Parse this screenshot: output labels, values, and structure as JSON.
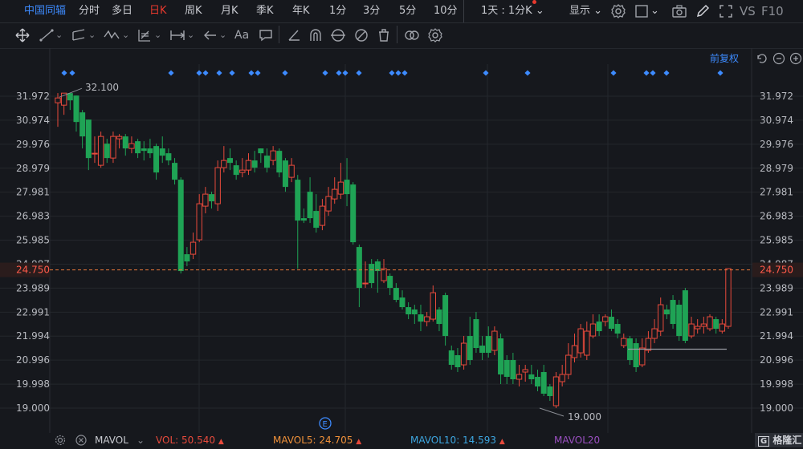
{
  "header": {
    "stock_name": "中国同辐",
    "periods": [
      "分时",
      "多日",
      "日K",
      "周K",
      "月K",
      "季K",
      "年K",
      "1分",
      "3分",
      "5分",
      "10分"
    ],
    "active_period": "日K",
    "interval_label": "1天 : 1分K",
    "display_label": "显示",
    "compare_label": "VS",
    "f10_label": "F10"
  },
  "toolbar": {
    "font_tool_label": "Aa"
  },
  "chart_area": {
    "adjust_label": "前复权"
  },
  "chart_data": {
    "type": "candlestick",
    "y_ticks": [
      "31.972",
      "30.974",
      "29.976",
      "28.979",
      "27.981",
      "26.983",
      "25.985",
      "24.987",
      "23.989",
      "22.991",
      "21.994",
      "20.996",
      "19.998",
      "19.000"
    ],
    "y_min": 19.0,
    "y_max": 31.972,
    "current_price": "24.750",
    "max_label": "32.100",
    "min_label": "19.000",
    "up_color": "#e84a3c",
    "down_color": "#1fa355",
    "candles": [
      {
        "o": 31.7,
        "c": 31.9,
        "h": 32.1,
        "l": 30.7
      },
      {
        "o": 31.6,
        "c": 32.1,
        "h": 32.1,
        "l": 31.2
      },
      {
        "o": 32.1,
        "c": 31.8,
        "h": 32.1,
        "l": 31.4
      },
      {
        "o": 32.0,
        "c": 30.9,
        "h": 32.0,
        "l": 30.5
      },
      {
        "o": 31.3,
        "c": 30.3,
        "h": 31.4,
        "l": 29.8
      },
      {
        "o": 31.0,
        "c": 29.4,
        "h": 31.0,
        "l": 28.9
      },
      {
        "o": 29.6,
        "c": 29.6,
        "h": 30.3,
        "l": 29.2
      },
      {
        "o": 29.1,
        "c": 30.3,
        "h": 30.5,
        "l": 29.0
      },
      {
        "o": 30.0,
        "c": 29.4,
        "h": 30.2,
        "l": 29.2
      },
      {
        "o": 29.4,
        "c": 30.3,
        "h": 30.5,
        "l": 29.2
      },
      {
        "o": 30.2,
        "c": 30.3,
        "h": 30.4,
        "l": 29.8
      },
      {
        "o": 30.3,
        "c": 29.8,
        "h": 30.4,
        "l": 29.5
      },
      {
        "o": 29.8,
        "c": 30.0,
        "h": 30.3,
        "l": 29.6
      },
      {
        "o": 30.1,
        "c": 29.6,
        "h": 30.2,
        "l": 29.4
      },
      {
        "o": 29.8,
        "c": 29.7,
        "h": 30.1,
        "l": 29.3
      },
      {
        "o": 29.8,
        "c": 29.6,
        "h": 30.2,
        "l": 29.4
      },
      {
        "o": 29.9,
        "c": 28.8,
        "h": 30.0,
        "l": 28.5
      },
      {
        "o": 29.8,
        "c": 29.5,
        "h": 30.3,
        "l": 29.2
      },
      {
        "o": 29.6,
        "c": 29.3,
        "h": 29.8,
        "l": 29.1
      },
      {
        "o": 29.2,
        "c": 28.5,
        "h": 29.4,
        "l": 28.3
      },
      {
        "o": 28.5,
        "c": 24.7,
        "h": 28.6,
        "l": 24.6
      },
      {
        "o": 25.4,
        "c": 25.1,
        "h": 25.7,
        "l": 24.9
      },
      {
        "o": 25.4,
        "c": 25.9,
        "h": 26.3,
        "l": 25.2
      },
      {
        "o": 26.0,
        "c": 27.5,
        "h": 27.9,
        "l": 25.9
      },
      {
        "o": 27.4,
        "c": 27.9,
        "h": 28.2,
        "l": 27.1
      },
      {
        "o": 27.9,
        "c": 27.6,
        "h": 28.0,
        "l": 27.3
      },
      {
        "o": 27.5,
        "c": 29.0,
        "h": 29.3,
        "l": 27.2
      },
      {
        "o": 29.0,
        "c": 29.3,
        "h": 29.9,
        "l": 28.8
      },
      {
        "o": 29.4,
        "c": 29.2,
        "h": 29.8,
        "l": 28.9
      },
      {
        "o": 29.1,
        "c": 28.7,
        "h": 29.3,
        "l": 28.5
      },
      {
        "o": 28.8,
        "c": 28.9,
        "h": 29.4,
        "l": 28.6
      },
      {
        "o": 28.9,
        "c": 29.3,
        "h": 29.6,
        "l": 28.7
      },
      {
        "o": 29.3,
        "c": 29.0,
        "h": 29.7,
        "l": 28.8
      },
      {
        "o": 29.8,
        "c": 29.6,
        "h": 29.8,
        "l": 29.2
      },
      {
        "o": 29.5,
        "c": 29.0,
        "h": 29.8,
        "l": 28.8
      },
      {
        "o": 29.3,
        "c": 29.7,
        "h": 29.9,
        "l": 29.1
      },
      {
        "o": 29.7,
        "c": 28.8,
        "h": 29.8,
        "l": 28.6
      },
      {
        "o": 29.3,
        "c": 28.2,
        "h": 29.4,
        "l": 28.0
      },
      {
        "o": 28.6,
        "c": 29.1,
        "h": 29.4,
        "l": 28.4
      },
      {
        "o": 28.5,
        "c": 26.8,
        "h": 28.7,
        "l": 24.8
      },
      {
        "o": 26.9,
        "c": 26.8,
        "h": 27.3,
        "l": 26.7
      },
      {
        "o": 28.0,
        "c": 26.9,
        "h": 28.6,
        "l": 26.7
      },
      {
        "o": 27.2,
        "c": 26.5,
        "h": 27.9,
        "l": 26.3
      },
      {
        "o": 26.6,
        "c": 27.4,
        "h": 27.7,
        "l": 26.4
      },
      {
        "o": 27.2,
        "c": 27.8,
        "h": 28.2,
        "l": 27.0
      },
      {
        "o": 27.7,
        "c": 28.1,
        "h": 28.6,
        "l": 27.5
      },
      {
        "o": 27.9,
        "c": 28.4,
        "h": 29.2,
        "l": 27.7
      },
      {
        "o": 28.5,
        "c": 27.9,
        "h": 29.4,
        "l": 27.4
      },
      {
        "o": 28.3,
        "c": 25.9,
        "h": 28.4,
        "l": 25.8
      },
      {
        "o": 25.7,
        "c": 24.0,
        "h": 25.8,
        "l": 23.2
      },
      {
        "o": 24.2,
        "c": 24.2,
        "h": 25.1,
        "l": 24.0
      },
      {
        "o": 25.0,
        "c": 24.2,
        "h": 25.2,
        "l": 24.0
      },
      {
        "o": 25.1,
        "c": 24.7,
        "h": 25.2,
        "l": 23.8
      },
      {
        "o": 24.3,
        "c": 24.8,
        "h": 25.2,
        "l": 24.2
      },
      {
        "o": 24.5,
        "c": 24.0,
        "h": 24.6,
        "l": 23.7
      },
      {
        "o": 24.0,
        "c": 23.5,
        "h": 24.2,
        "l": 23.4
      },
      {
        "o": 23.6,
        "c": 23.2,
        "h": 23.9,
        "l": 23.1
      },
      {
        "o": 23.2,
        "c": 22.9,
        "h": 23.4,
        "l": 22.7
      },
      {
        "o": 23.1,
        "c": 22.9,
        "h": 23.3,
        "l": 22.5
      },
      {
        "o": 22.9,
        "c": 22.6,
        "h": 23.3,
        "l": 22.2
      },
      {
        "o": 22.6,
        "c": 22.8,
        "h": 23.0,
        "l": 22.4
      },
      {
        "o": 22.7,
        "c": 23.8,
        "h": 24.1,
        "l": 22.6
      },
      {
        "o": 23.1,
        "c": 22.5,
        "h": 23.2,
        "l": 22.2
      },
      {
        "o": 23.7,
        "c": 22.0,
        "h": 23.8,
        "l": 21.6
      },
      {
        "o": 21.4,
        "c": 20.8,
        "h": 21.6,
        "l": 20.6
      },
      {
        "o": 21.2,
        "c": 20.7,
        "h": 21.5,
        "l": 20.5
      },
      {
        "o": 20.8,
        "c": 21.7,
        "h": 22.0,
        "l": 20.6
      },
      {
        "o": 22.0,
        "c": 21.0,
        "h": 22.8,
        "l": 20.8
      },
      {
        "o": 22.7,
        "c": 21.5,
        "h": 23.0,
        "l": 21.3
      },
      {
        "o": 21.6,
        "c": 21.3,
        "h": 22.0,
        "l": 21.0
      },
      {
        "o": 22.0,
        "c": 21.3,
        "h": 22.4,
        "l": 21.1
      },
      {
        "o": 21.4,
        "c": 22.2,
        "h": 22.4,
        "l": 21.2
      },
      {
        "o": 21.9,
        "c": 20.4,
        "h": 22.1,
        "l": 20.0
      },
      {
        "o": 21.0,
        "c": 20.3,
        "h": 21.2,
        "l": 20.0
      },
      {
        "o": 21.0,
        "c": 20.2,
        "h": 21.3,
        "l": 20.0
      },
      {
        "o": 20.2,
        "c": 20.4,
        "h": 20.8,
        "l": 19.9
      },
      {
        "o": 20.5,
        "c": 20.6,
        "h": 20.8,
        "l": 20.1
      },
      {
        "o": 20.4,
        "c": 20.2,
        "h": 20.8,
        "l": 20.0
      },
      {
        "o": 20.3,
        "c": 19.9,
        "h": 20.6,
        "l": 19.7
      },
      {
        "o": 20.5,
        "c": 19.6,
        "h": 20.8,
        "l": 19.5
      },
      {
        "o": 19.9,
        "c": 19.5,
        "h": 20.0,
        "l": 19.3
      },
      {
        "o": 19.1,
        "c": 20.3,
        "h": 20.5,
        "l": 19.0
      },
      {
        "o": 20.1,
        "c": 20.4,
        "h": 20.8,
        "l": 19.9
      },
      {
        "o": 20.4,
        "c": 21.2,
        "h": 21.7,
        "l": 20.2
      },
      {
        "o": 21.1,
        "c": 21.6,
        "h": 22.1,
        "l": 20.9
      },
      {
        "o": 21.3,
        "c": 22.3,
        "h": 22.5,
        "l": 21.1
      },
      {
        "o": 21.2,
        "c": 22.2,
        "h": 22.6,
        "l": 21.0
      },
      {
        "o": 22.0,
        "c": 22.5,
        "h": 22.9,
        "l": 21.9
      },
      {
        "o": 22.6,
        "c": 22.2,
        "h": 22.9,
        "l": 22.0
      },
      {
        "o": 22.6,
        "c": 22.8,
        "h": 22.9,
        "l": 22.4
      },
      {
        "o": 22.8,
        "c": 22.3,
        "h": 23.1,
        "l": 22.2
      },
      {
        "o": 22.5,
        "c": 22.1,
        "h": 22.7,
        "l": 21.9
      },
      {
        "o": 21.6,
        "c": 21.9,
        "h": 22.1,
        "l": 21.5
      },
      {
        "o": 21.9,
        "c": 21.0,
        "h": 22.0,
        "l": 20.8
      },
      {
        "o": 21.7,
        "c": 20.7,
        "h": 21.9,
        "l": 20.5
      },
      {
        "o": 20.8,
        "c": 21.5,
        "h": 21.9,
        "l": 20.7
      },
      {
        "o": 21.4,
        "c": 21.9,
        "h": 22.2,
        "l": 21.3
      },
      {
        "o": 21.9,
        "c": 22.3,
        "h": 22.7,
        "l": 21.7
      },
      {
        "o": 22.2,
        "c": 23.3,
        "h": 23.6,
        "l": 22.0
      },
      {
        "o": 23.1,
        "c": 22.9,
        "h": 23.3,
        "l": 22.7
      },
      {
        "o": 23.5,
        "c": 22.5,
        "h": 23.7,
        "l": 22.3
      },
      {
        "o": 23.3,
        "c": 22.0,
        "h": 23.5,
        "l": 21.8
      },
      {
        "o": 23.9,
        "c": 21.8,
        "h": 24.0,
        "l": 21.7
      },
      {
        "o": 22.0,
        "c": 22.5,
        "h": 22.8,
        "l": 21.9
      },
      {
        "o": 22.3,
        "c": 22.4,
        "h": 22.7,
        "l": 22.1
      },
      {
        "o": 22.4,
        "c": 22.5,
        "h": 22.8,
        "l": 22.1
      },
      {
        "o": 22.3,
        "c": 22.8,
        "h": 22.9,
        "l": 22.2
      },
      {
        "o": 22.7,
        "c": 22.3,
        "h": 22.8,
        "l": 22.1
      },
      {
        "o": 22.2,
        "c": 22.5,
        "h": 22.7,
        "l": 22.1
      },
      {
        "o": 22.4,
        "c": 24.8,
        "h": 24.8,
        "l": 22.3
      }
    ]
  },
  "indicator": {
    "name": "MAVOL",
    "vol_label": "VOL: 50.540",
    "vol_color": "#e84a3c",
    "ma5_label": "MAVOL5: 24.705",
    "ma5_color": "#f0913a",
    "ma10_label": "MAVOL10: 14.593",
    "ma10_color": "#3da6e0",
    "ma20_label": "MAVOL20",
    "ma20_color": "#9a4fc0"
  },
  "watermark": {
    "text": "格隆汇"
  },
  "event_marker_label": "E"
}
